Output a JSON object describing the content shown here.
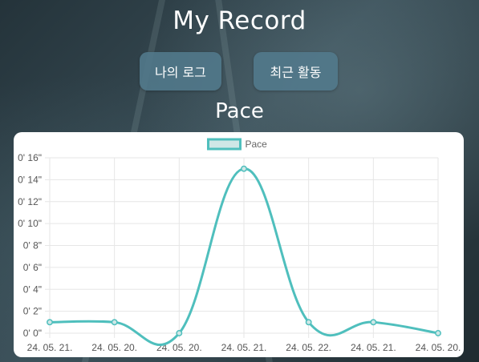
{
  "header": {
    "title": "My Record",
    "subtitle": "Pace"
  },
  "buttons": {
    "my_log": "나의 로그",
    "recent_activity": "최근 활동"
  },
  "colors": {
    "line": "#4fbfbd",
    "legend_fill": "#cfe7e6",
    "grid": "#e6e6e6"
  },
  "chart_data": {
    "type": "line",
    "title": "",
    "categories": [
      "24. 05. 21.",
      "24. 05. 20.",
      "24. 05. 20.",
      "24. 05. 21.",
      "24. 05. 22.",
      "24. 05. 21.",
      "24. 05. 20."
    ],
    "series": [
      {
        "name": "Pace",
        "values": [
          1,
          1,
          0,
          15,
          1,
          1,
          0
        ]
      }
    ],
    "y_ticks": [
      "0' 0\"",
      "0' 2\"",
      "0' 4\"",
      "0' 6\"",
      "0' 8\"",
      "0' 10\"",
      "0' 12\"",
      "0' 14\"",
      "0' 16\""
    ],
    "ylim": [
      0,
      16
    ],
    "legend_position": "top",
    "grid": true
  }
}
